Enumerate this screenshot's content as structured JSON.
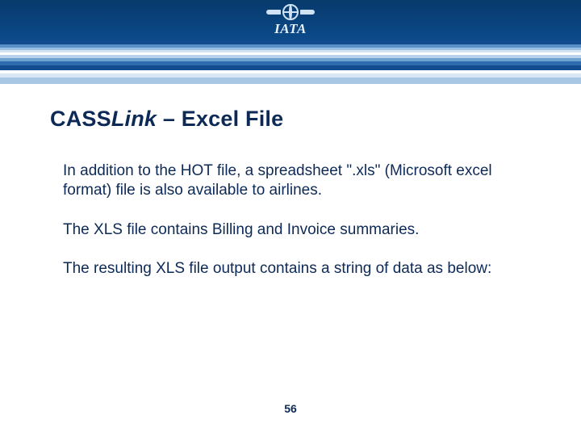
{
  "header": {
    "logo_text": "IATA",
    "band_colors": [
      "#0b2f55",
      "#134c8e",
      "#5a90c7",
      "#9cc0e1",
      "#d2e2f1",
      "#ffffff",
      "#b7d2ea",
      "#6fa2d1",
      "#2f6cae",
      "#134c8e",
      "#ffffff",
      "#d9e7f4",
      "#a7c7e4"
    ],
    "band_heights": [
      50,
      5,
      4,
      3,
      3,
      3,
      4,
      4,
      5,
      6,
      4,
      5,
      8
    ]
  },
  "title": {
    "prefix": "CASS",
    "italic_part": "Link",
    "suffix": " – Excel File"
  },
  "paragraphs": [
    "In addition to the HOT file, a spreadsheet \".xls\" (Microsoft excel format) file is also available to airlines.",
    "The XLS file contains Billing and Invoice summaries.",
    "The resulting XLS file output contains a string of data as below:"
  ],
  "page_number": "56"
}
